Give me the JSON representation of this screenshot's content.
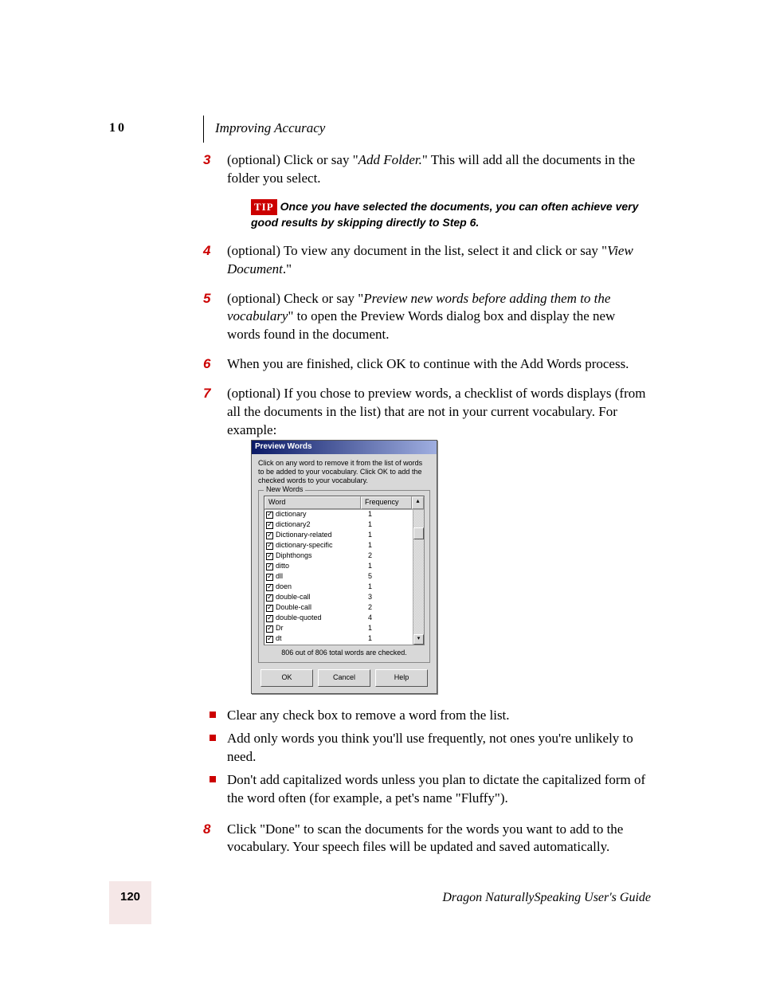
{
  "header": {
    "chapter_num": "10",
    "chapter_title": "Improving Accuracy"
  },
  "steps": {
    "s3": {
      "num": "3",
      "text_a": "(optional) Click or say \"",
      "cmd": "Add Folder.",
      "text_b": "\" This will add all the documents in the folder you select."
    },
    "tip": {
      "label": "TIP",
      "text": "Once you have selected the documents, you can often achieve very good results by skipping directly to Step 6."
    },
    "s4": {
      "num": "4",
      "text_a": "(optional) To view any document in the list, select it and click or say \"",
      "cmd": "View Document",
      "text_b": ".\""
    },
    "s5": {
      "num": "5",
      "text_a": "(optional) Check or say \"",
      "cmd": "Preview new words before adding them to the vocabulary",
      "text_b": "\" to open the Preview Words dialog box and display the new words found in the document."
    },
    "s6": {
      "num": "6",
      "text": "When you are finished, click OK to continue with the Add Words process."
    },
    "s7": {
      "num": "7",
      "text": "(optional) If you chose to preview words, a checklist of words displays (from all the documents in the list) that are not in your current vocabulary. For example:"
    },
    "s8": {
      "num": "8",
      "text": "Click \"Done\" to scan the documents for the words you want to add to the vocabulary. Your speech files will be updated and saved automatically."
    }
  },
  "bullets": {
    "b1": "Clear any check box to remove a word from the list.",
    "b2": "Add only words you think you'll use frequently, not ones you're unlikely to need.",
    "b3": "Don't add capitalized words unless you plan to dictate the capitalized form of the word often (for example, a pet's name \"Fluffy\")."
  },
  "dialog": {
    "title": "Preview Words",
    "instruction": "Click on any word to remove it from the list of words to be added to your vocabulary. Click OK to add the checked words to your vocabulary.",
    "group_label": "New Words",
    "col_word": "Word",
    "col_freq": "Frequency",
    "rows": [
      {
        "word": "dictionary",
        "freq": "1"
      },
      {
        "word": "dictionary2",
        "freq": "1"
      },
      {
        "word": "Dictionary-related",
        "freq": "1"
      },
      {
        "word": "dictionary-specific",
        "freq": "1"
      },
      {
        "word": "Diphthongs",
        "freq": "2"
      },
      {
        "word": "ditto",
        "freq": "1"
      },
      {
        "word": "dll",
        "freq": "5"
      },
      {
        "word": "doen",
        "freq": "1"
      },
      {
        "word": "double-call",
        "freq": "3"
      },
      {
        "word": "Double-call",
        "freq": "2"
      },
      {
        "word": "double-quoted",
        "freq": "4"
      },
      {
        "word": "Dr",
        "freq": "1"
      },
      {
        "word": "dt",
        "freq": "1"
      }
    ],
    "status": "806 out of 806 total words are checked.",
    "btn_ok": "OK",
    "btn_cancel": "Cancel",
    "btn_help": "Help",
    "scroll_up": "▴",
    "scroll_down": "▾"
  },
  "footer": {
    "page": "120",
    "guide": "Dragon NaturallySpeaking User's Guide"
  }
}
